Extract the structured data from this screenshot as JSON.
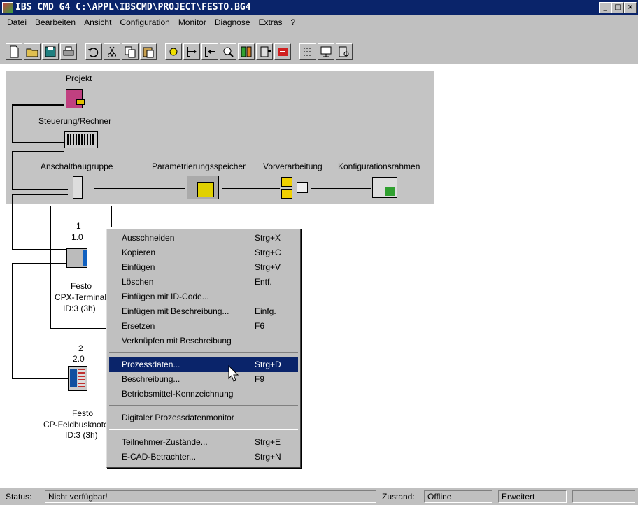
{
  "window": {
    "title": "IBS CMD G4 C:\\APPL\\IBSCMD\\PROJECT\\FESTO.BG4",
    "min": "_",
    "max": "□",
    "close": "×"
  },
  "menu": {
    "datei": "Datei",
    "bearbeiten": "Bearbeiten",
    "ansicht": "Ansicht",
    "configuration": "Configuration",
    "monitor": "Monitor",
    "diagnose": "Diagnose",
    "extras": "Extras",
    "help": "?"
  },
  "toolbar_icons": [
    "new-icon",
    "open-icon",
    "save-icon",
    "print-icon",
    "undo-icon",
    "cut-icon",
    "copy-icon",
    "paste-icon",
    "config-icon",
    "download-icon",
    "upload-icon",
    "search-icon",
    "compare-icon",
    "device-icon",
    "monitor-icon",
    "grid-icon",
    "display-icon",
    "diagnose-icon"
  ],
  "tree": {
    "projekt": "Projekt",
    "steuerung": "Steuerung/Rechner",
    "anschalt": "Anschaltbaugruppe",
    "param": "Parametrierungsspeicher",
    "vorver": "Vorverarbeitung",
    "konfig": "Konfigurationsrahmen",
    "dev1": {
      "num": "1",
      "addr": "1.0",
      "maker": "Festo",
      "name": "CPX-Terminal",
      "id": "ID:3 (3h)"
    },
    "dev2": {
      "num": "2",
      "addr": "2.0",
      "maker": "Festo",
      "name": "CP-Feldbusknoten",
      "id": "ID:3 (3h)"
    }
  },
  "context_menu": {
    "items": [
      {
        "label": "Ausschneiden",
        "shortcut": "Strg+X"
      },
      {
        "label": "Kopieren",
        "shortcut": "Strg+C"
      },
      {
        "label": "Einfügen",
        "shortcut": "Strg+V"
      },
      {
        "label": "Löschen",
        "shortcut": "Entf."
      },
      {
        "label": "Einfügen mit ID-Code...",
        "shortcut": ""
      },
      {
        "label": "Einfügen mit Beschreibung...",
        "shortcut": "Einfg."
      },
      {
        "label": "Ersetzen",
        "shortcut": "F6"
      },
      {
        "label": "Verknüpfen mit Beschreibung",
        "shortcut": ""
      },
      {
        "label": "Prozessdaten...",
        "shortcut": "Strg+D"
      },
      {
        "label": "Beschreibung...",
        "shortcut": "F9"
      },
      {
        "label": "Betriebsmittel-Kennzeichnung",
        "shortcut": ""
      },
      {
        "label": "Digitaler Prozessdatenmonitor",
        "shortcut": ""
      },
      {
        "label": "Teilnehmer-Zustände...",
        "shortcut": "Strg+E"
      },
      {
        "label": "E-CAD-Betrachter...",
        "shortcut": "Strg+N"
      }
    ]
  },
  "status": {
    "label": "Status:",
    "value": "Nicht verfügbar!",
    "zustand_label": "Zustand:",
    "zustand_value": "Offline",
    "mode": "Erweitert"
  }
}
